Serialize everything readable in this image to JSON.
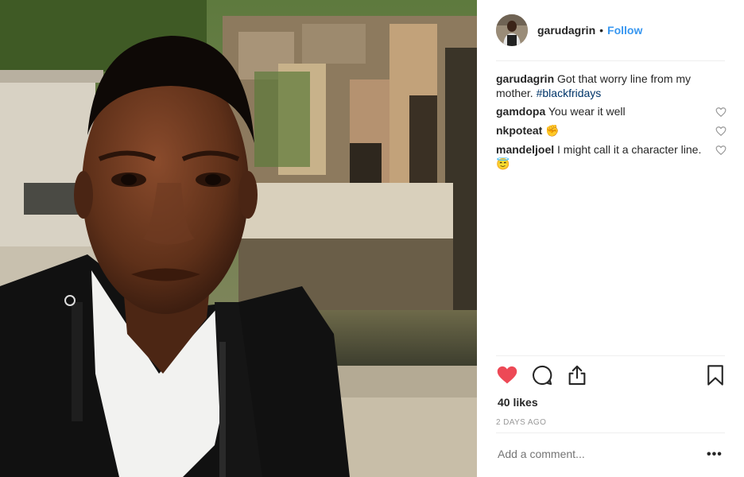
{
  "post": {
    "username": "garudagrin",
    "separator": "•",
    "follow_label": "Follow",
    "caption_text": "Got that worry line from my mother.",
    "caption_hashtag": "#blackfridays"
  },
  "comments": [
    {
      "user": "gamdopa",
      "text": "You wear it well",
      "emoji": ""
    },
    {
      "user": "nkpoteat",
      "text": "",
      "emoji": "✊"
    },
    {
      "user": "mandeljoel",
      "text": "I might call it a character line.",
      "emoji": "😇"
    }
  ],
  "stats": {
    "likes": "40 likes",
    "timestamp": "2 DAYS AGO"
  },
  "composer": {
    "placeholder": "Add a comment...",
    "more_label": "•••"
  },
  "icons": {
    "like": "heart-filled-icon",
    "comment": "comment-bubble-icon",
    "share": "share-icon",
    "save": "bookmark-icon"
  },
  "colors": {
    "heart_active": "#ed4956",
    "link_blue": "#3897f0",
    "hashtag": "#003569"
  }
}
